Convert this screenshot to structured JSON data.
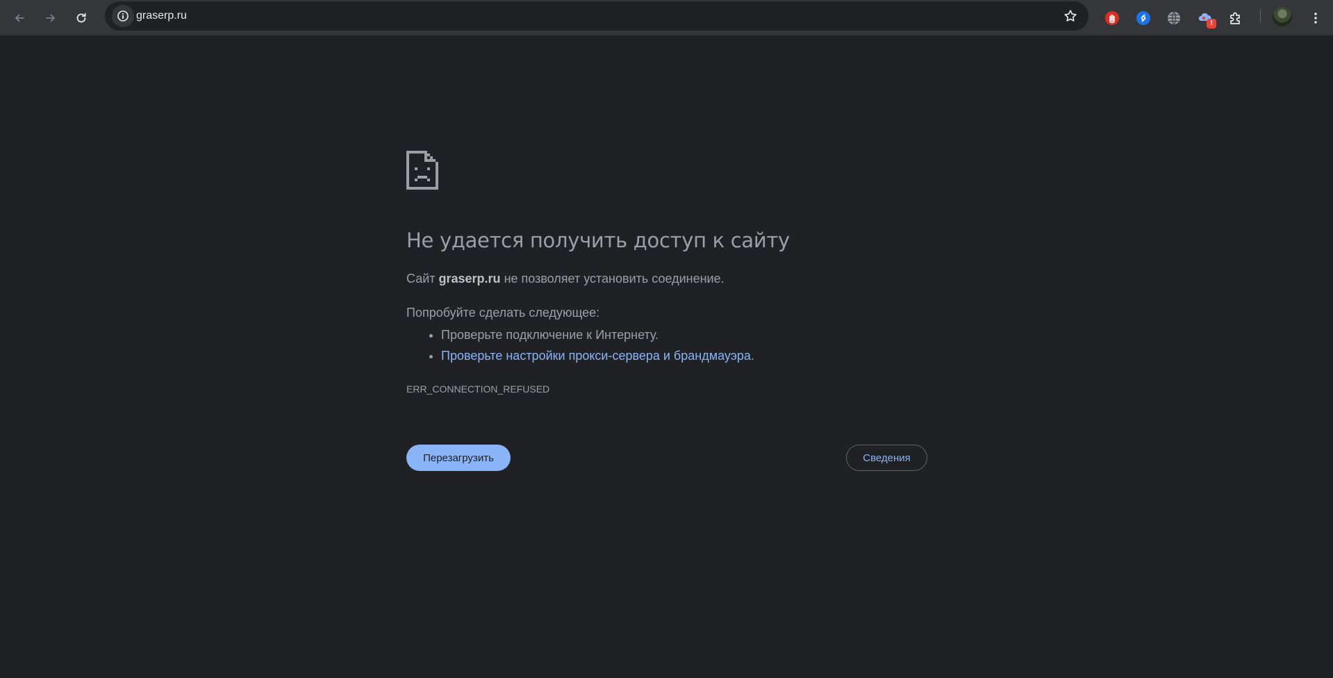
{
  "browser": {
    "url": "graserp.ru",
    "icons": {
      "back": "arrow-left-icon",
      "forward": "arrow-right-icon",
      "reload": "reload-icon",
      "site_info": "info-icon",
      "bookmark": "star-icon",
      "menu": "kebab-menu-icon"
    },
    "extensions": [
      {
        "name": "extension-hand-stop",
        "color": "#e1312b"
      },
      {
        "name": "extension-shazam",
        "color": "#1a73e8"
      },
      {
        "name": "extension-globe",
        "color": "#bdc1c6"
      },
      {
        "name": "extension-alert",
        "color": "#8ab4f8",
        "badge": "!"
      },
      {
        "name": "extensions-puzzle",
        "color": "#c4c7c5"
      }
    ]
  },
  "error_page": {
    "heading": "Не удается получить доступ к сайту",
    "summary_prefix": "Сайт ",
    "summary_host": "graserp.ru",
    "summary_suffix": " не позволяет установить соединение.",
    "suggestions_title": "Попробуйте сделать следующее:",
    "suggestion_1": "Проверьте подключение к Интернету.",
    "suggestion_2_link": "Проверьте настройки прокси-сервера и брандмауэра",
    "suggestion_2_tail": ".",
    "error_code": "ERR_CONNECTION_REFUSED",
    "reload_button": "Перезагрузить",
    "details_button": "Сведения"
  },
  "colors": {
    "background": "#202124",
    "toolbar": "#35363a",
    "text": "#9aa0a6",
    "link": "#8ab4f8",
    "primary_button": "#8ab4f8"
  }
}
